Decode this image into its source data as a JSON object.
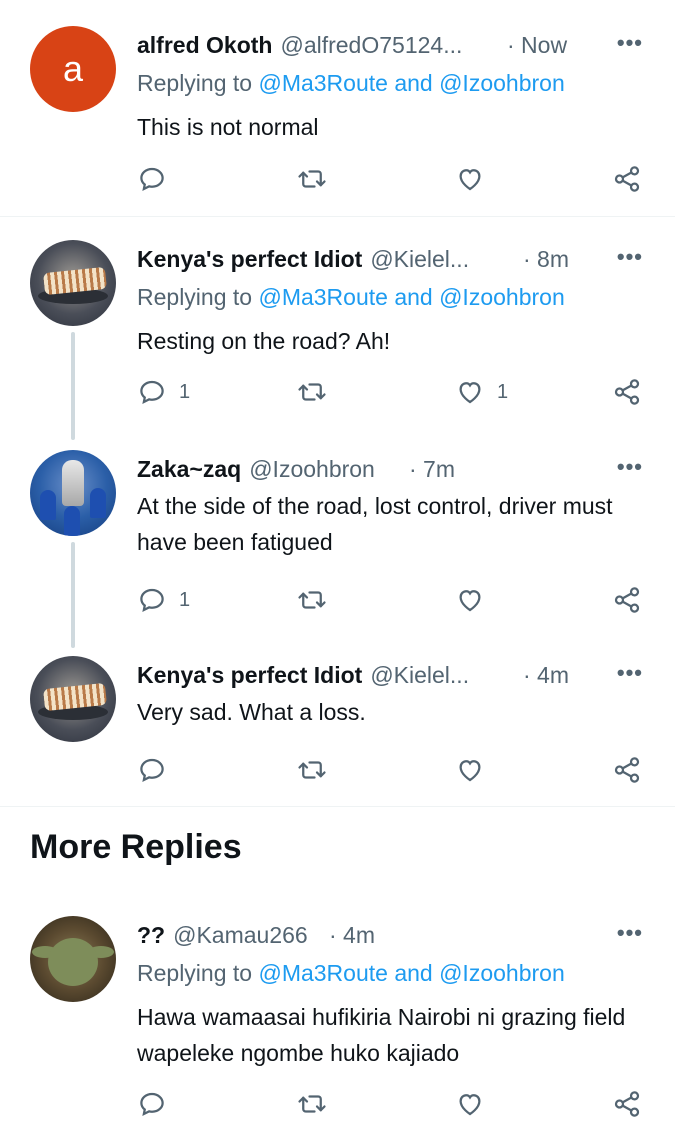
{
  "tweets": [
    {
      "name": "alfred Okoth",
      "handle": "@alfredO75124...",
      "time": "· Now",
      "more": "•••",
      "avatar_letter": "a",
      "replying_prefix": "Replying to ",
      "replying_mentions": "@Ma3Route and @Izoohbron",
      "text": "This is not normal",
      "reply_count": "",
      "like_count": ""
    },
    {
      "name": "Kenya's perfect Idiot",
      "handle": "@Kielel...",
      "time": "· 8m",
      "more": "•••",
      "replying_prefix": "Replying to ",
      "replying_mentions": "@Ma3Route and @Izoohbron",
      "text": "Resting on the road? Ah!",
      "reply_count": "1",
      "like_count": "1"
    },
    {
      "name": "Zaka~zaq",
      "handle": "@Izoohbron",
      "time": "· 7m",
      "more": "•••",
      "text": "At the side of the road, lost control, driver must have been fatigued",
      "reply_count": "1",
      "like_count": ""
    },
    {
      "name": "Kenya's perfect Idiot",
      "handle": "@Kielel...",
      "time": "· 4m",
      "more": "•••",
      "text": "Very sad. What a loss.",
      "reply_count": "",
      "like_count": ""
    },
    {
      "name": "??",
      "handle": "@Kamau266",
      "time": "· 4m",
      "more": "•••",
      "replying_prefix": "Replying to ",
      "replying_mentions": "@Ma3Route and @Izoohbron",
      "text": "Hawa wamaasai hufikiria Nairobi ni grazing field wapeleke ngombe huko kajiado",
      "reply_count": "",
      "like_count": ""
    }
  ],
  "more_replies_title": "More Replies",
  "icons": [
    "reply-icon",
    "retweet-icon",
    "like-icon",
    "share-icon",
    "more-icon"
  ],
  "colors": {
    "text": "#0f1419",
    "secondary": "#536471",
    "link": "#1d9bf0",
    "avatar_a": "#d84315",
    "thread_line": "#cfd9de"
  }
}
